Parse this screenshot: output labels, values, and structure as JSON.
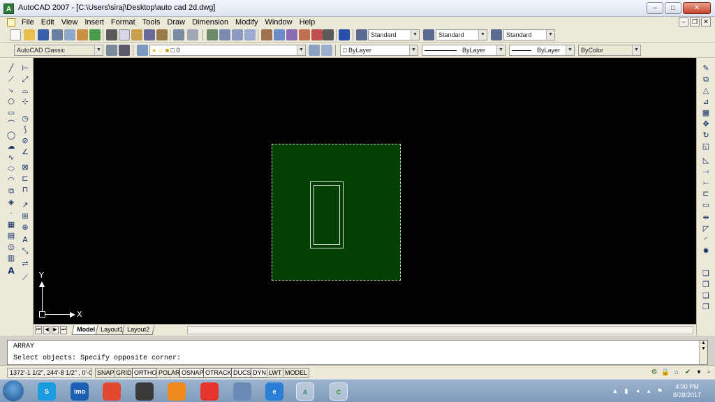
{
  "window": {
    "title": "AutoCAD 2007 - [C:\\Users\\siraj\\Desktop\\auto cad 2d.dwg]",
    "app_icon": "A"
  },
  "menu": [
    "File",
    "Edit",
    "View",
    "Insert",
    "Format",
    "Tools",
    "Draw",
    "Dimension",
    "Modify",
    "Window",
    "Help"
  ],
  "styles": {
    "text_style": "Standard",
    "dim_style": "Standard",
    "table_style": "Standard"
  },
  "workspace": "AutoCAD Classic",
  "layer": {
    "name": "0"
  },
  "properties": {
    "color": "ByLayer",
    "linetype": "ByLayer",
    "lineweight": "ByLayer",
    "plot_style": "ByColor"
  },
  "ucs": {
    "x_label": "X",
    "y_label": "Y"
  },
  "layout_tabs": [
    "Model",
    "Layout1",
    "Layout2"
  ],
  "command": {
    "history": "ARRAY",
    "current": "Select objects: Specify opposite corner:"
  },
  "status": {
    "coordinates": "1372'-1 1/2\", 244'-8 1/2\" , 0'-0\"",
    "toggles": [
      "SNAP",
      "GRID",
      "ORTHO",
      "POLAR",
      "OSNAP",
      "OTRACK",
      "DUCS",
      "DYN",
      "LWT",
      "MODEL"
    ]
  },
  "taskbar": {
    "apps": [
      {
        "name": "skype",
        "label": "S",
        "color": "#1b9be0"
      },
      {
        "name": "imo",
        "label": "imo",
        "color": "#1d5fb3"
      },
      {
        "name": "chrome",
        "label": "",
        "color": "#e2482f"
      },
      {
        "name": "angry-app",
        "label": "",
        "color": "#3a3a3a"
      },
      {
        "name": "uc-browser",
        "label": "",
        "color": "#f08a1e"
      },
      {
        "name": "downloader",
        "label": "",
        "color": "#e5352c"
      },
      {
        "name": "installer",
        "label": "",
        "color": "#6a8ab8"
      },
      {
        "name": "internet-explorer",
        "label": "e",
        "color": "#2a7fd4"
      },
      {
        "name": "autocad",
        "label": "A",
        "color": "#3c8a6e"
      },
      {
        "name": "camtasia",
        "label": "C",
        "color": "#2e8a2e"
      }
    ],
    "clock_time": "4:00 PM",
    "clock_date": "8/28/2017"
  }
}
